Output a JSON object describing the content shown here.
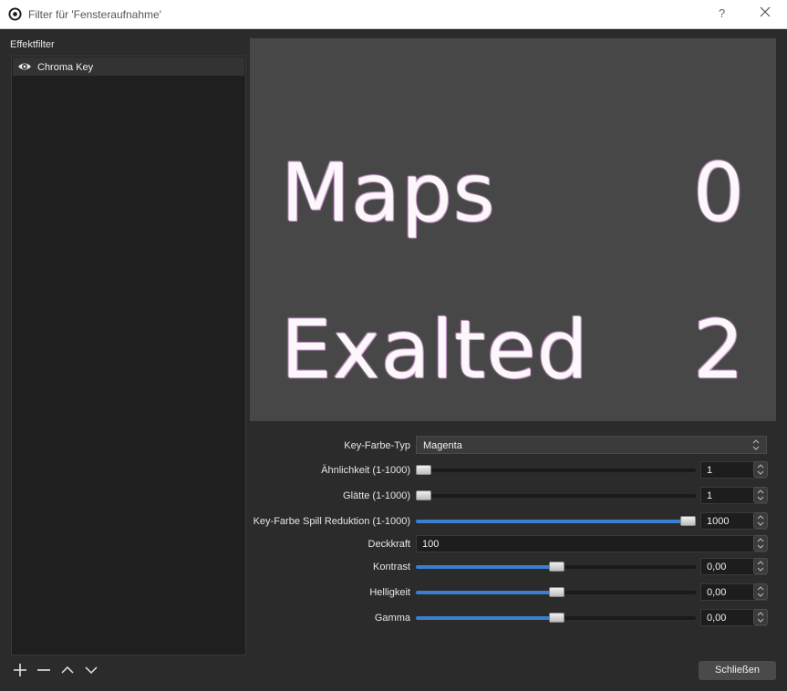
{
  "window": {
    "title": "Filter für 'Fensteraufnahme'",
    "help": "?"
  },
  "sidebar": {
    "label": "Effektfilter",
    "items": [
      {
        "label": "Chroma Key",
        "icon": "eye-icon"
      }
    ]
  },
  "preview": {
    "line1_left": "Maps",
    "line1_right": "0",
    "line2_left": "Exalted",
    "line2_right": "2",
    "background": "#474747"
  },
  "properties": {
    "key_color_type": {
      "label": "Key-Farbe-Typ",
      "value": "Magenta"
    },
    "similarity": {
      "label": "Ähnlichkeit (1-1000)",
      "value": "1",
      "fraction": 0.0
    },
    "smoothness": {
      "label": "Glätte (1-1000)",
      "value": "1",
      "fraction": 0.0
    },
    "spill": {
      "label": "Key-Farbe Spill Reduktion (1-1000)",
      "value": "1000",
      "fraction": 1.0
    },
    "opacity": {
      "label": "Deckkraft",
      "value": "100"
    },
    "contrast": {
      "label": "Kontrast",
      "value": "0,00",
      "fraction": 0.5
    },
    "brightness": {
      "label": "Helligkeit",
      "value": "0,00",
      "fraction": 0.5
    },
    "gamma": {
      "label": "Gamma",
      "value": "0,00",
      "fraction": 0.5
    }
  },
  "footer": {
    "close_label": "Schließen"
  },
  "colors": {
    "accent": "#3a7fd0",
    "panel": "#2b2b2b",
    "list_bg": "#1f1f1f"
  }
}
